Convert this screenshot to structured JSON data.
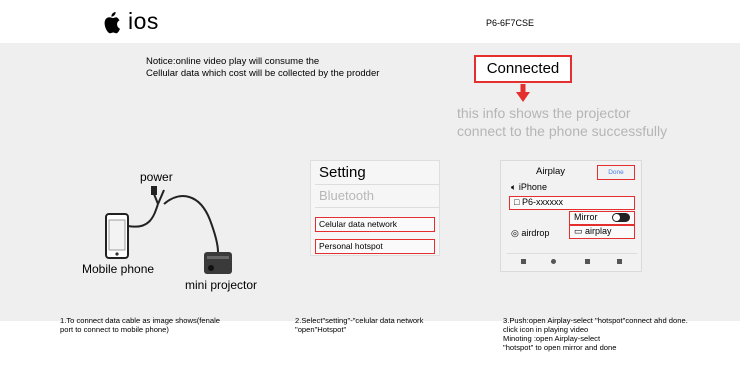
{
  "header": {
    "os_label": "ios",
    "model_code": "P6-6F7CSE"
  },
  "notice": {
    "line1": "Notice:online video play will consume the",
    "line2": "Cellular data which cost will be collected by the prodder"
  },
  "status": {
    "connected_label": "Connected",
    "info_line1": "this info shows the projector",
    "info_line2": "connect to the phone successfully",
    "accent_color": "#e3302f"
  },
  "step1": {
    "power_label": "power",
    "mobile_label": "Mobile phone",
    "projector_label": "mini projector",
    "caption_line1": "1.To connect data cable as image shows(fenale",
    "caption_line2": "port to connect to mobile phone)"
  },
  "step2": {
    "title": "Setting",
    "bluetooth": "Bluetooth",
    "cellular": "Celular data network",
    "hotspot": "Personal hotspot",
    "caption_line1": "2.Select\"setting\"-\"celular data network",
    "caption_line2": "\"open\"Hotspot\""
  },
  "step3": {
    "title": "Airplay",
    "done": "Done",
    "iphone": "iPhone",
    "device": "P6-xxxxxx",
    "mirror": "Mirror",
    "airdrop": "airdrop",
    "airplay": "airplay",
    "caption_line1": "3.Push:open Airplay-select \"hotspot\"connect ahd  done.",
    "caption_line2": "click icon in playing  video",
    "caption_line3": "Minoting :open  Airplay-select",
    "caption_line4": "\"hotspot\" to open mirror and done"
  }
}
